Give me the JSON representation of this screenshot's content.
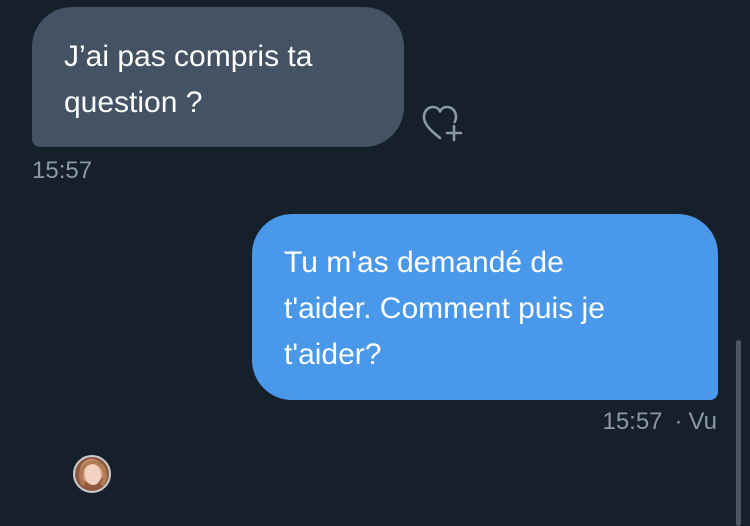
{
  "conversation": {
    "messages": [
      {
        "direction": "received",
        "text": "J’ai pas compris ta\nquestion ?",
        "timestamp": "15:57",
        "actions": {
          "react_icon": "heart-plus-icon"
        }
      },
      {
        "direction": "sent",
        "text": "Tu m'as demandé de\nt'aider. Comment puis je\nt'aider?",
        "timestamp": "15:57",
        "separator": "·",
        "status": "Vu"
      }
    ],
    "seen_avatar_icon": "avatar-icon"
  },
  "colors": {
    "background": "#15202b",
    "received_bubble": "#435363",
    "sent_bubble": "#4a98e9",
    "timestamp": "#8b98a5"
  }
}
